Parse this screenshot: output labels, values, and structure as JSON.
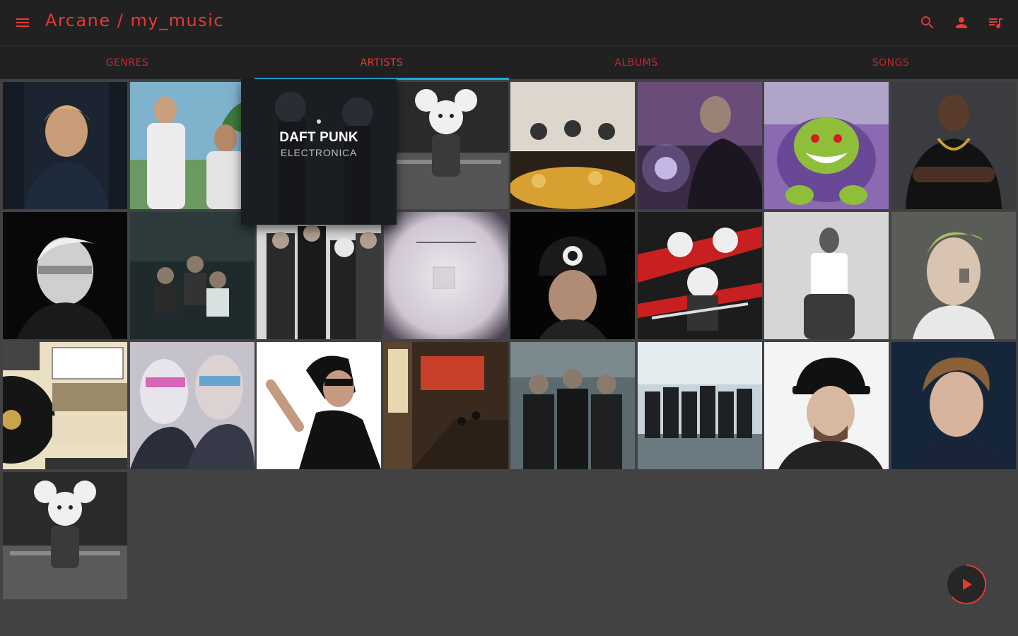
{
  "app": {
    "title": "Arcane / my_music",
    "accent_color": "#e53935",
    "tab_indicator_color": "#1fa8d8",
    "icons": [
      "menu-icon",
      "search-icon",
      "person-icon",
      "queue-music-icon",
      "play-icon"
    ]
  },
  "tabs": [
    {
      "label": "GENRES",
      "active": false
    },
    {
      "label": "ARTISTS",
      "active": true
    },
    {
      "label": "ALBUMS",
      "active": false
    },
    {
      "label": "SONGS",
      "active": false
    }
  ],
  "hovered_artist": {
    "name": "DAFT PUNK",
    "genre": "ELECTRONICA"
  }
}
